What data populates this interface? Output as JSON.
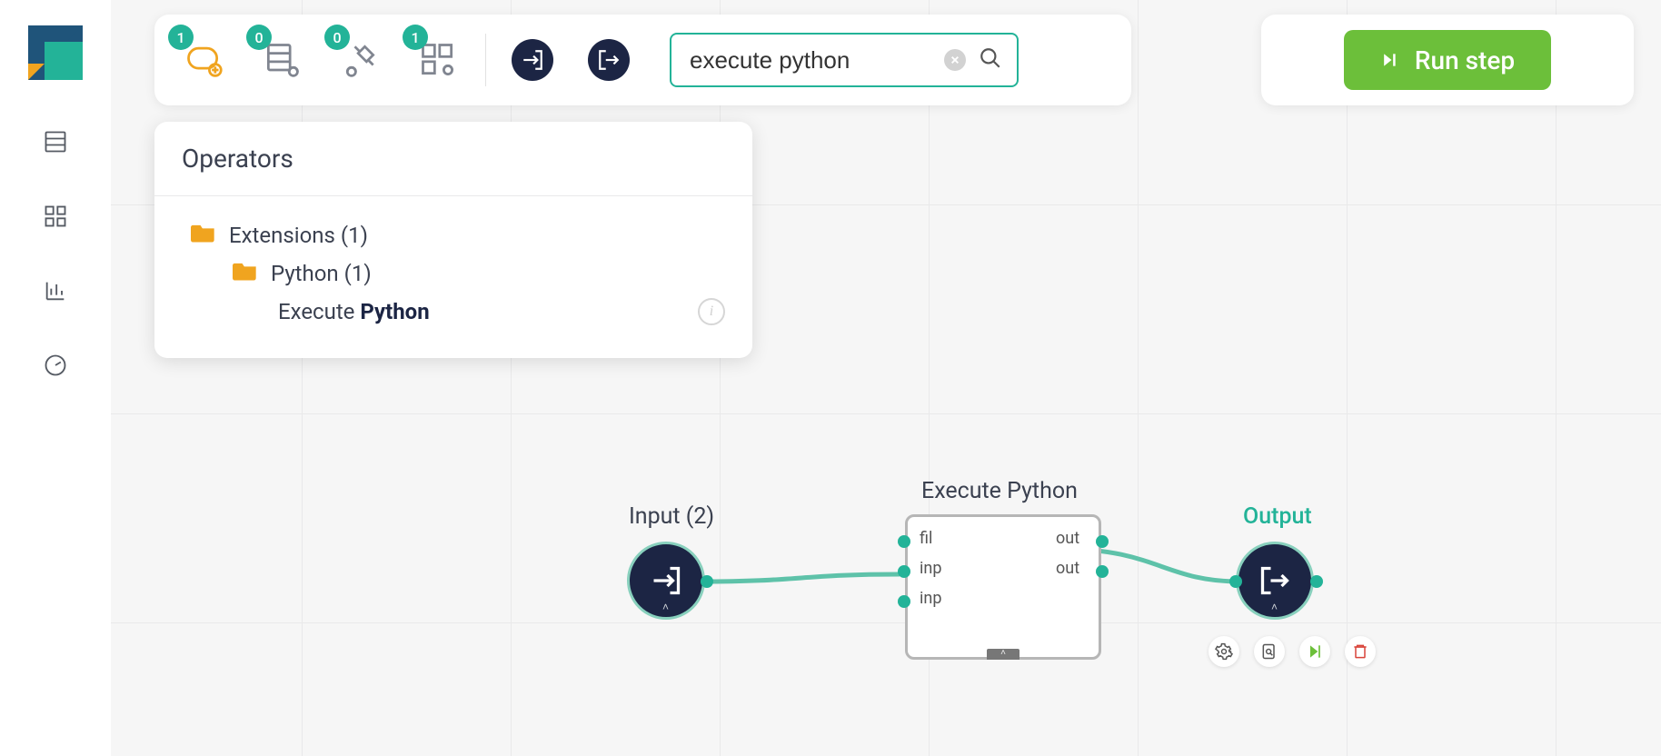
{
  "toolbar": {
    "badges": {
      "loop": "1",
      "db": "0",
      "plug": "0",
      "grid": "1"
    }
  },
  "search": {
    "value": "execute python"
  },
  "run_button_label": "Run step",
  "operators_panel": {
    "title": "Operators",
    "tree": {
      "root_label": "Extensions (1)",
      "sub_label": "Python (1)",
      "leaf_prefix": "Execute ",
      "leaf_match": "Python"
    }
  },
  "workflow": {
    "input_label": "Input (2)",
    "output_label": "Output",
    "exec_label": "Execute Python",
    "ports": {
      "in0": "fil",
      "in1": "inp",
      "in2": "inp",
      "out0": "out",
      "out1": "out"
    }
  }
}
